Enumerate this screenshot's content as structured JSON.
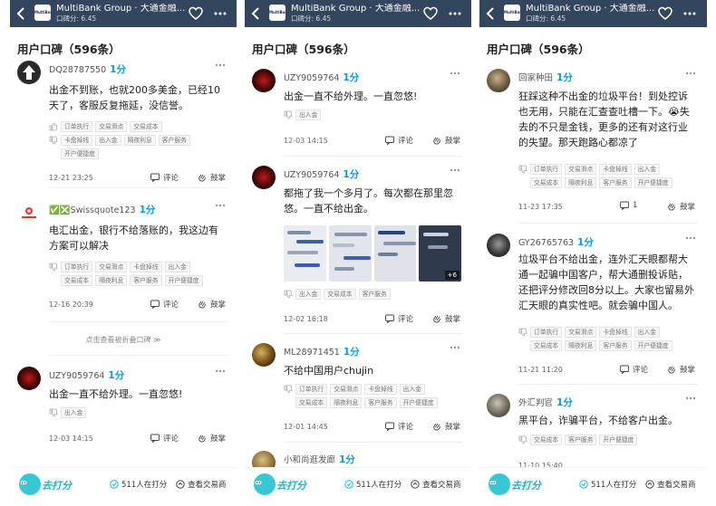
{
  "header": {
    "title": "MultiBank Group · 大通金融...",
    "subtitle": "口碑分: 6.45",
    "logo_text": "MultiBank"
  },
  "section_title": "用户口碑（596条）",
  "actions": {
    "comment": "评论",
    "like": "鼓掌"
  },
  "fold_text": "点击查看被折叠口碑",
  "bottom_bar": {
    "logo_text": "去打分",
    "rating_count": "511人在打分",
    "view": "查看交易商"
  },
  "panels": [
    {
      "reviews": [
        {
          "user": "DQ28787550",
          "score": "1分",
          "text": "出金不到账，也就200多美金，已经10天了，客服反复拖延，没信誉。",
          "tags1": [
            "订单执行",
            "交易滑点",
            "交易成本"
          ],
          "tags2": [
            "卡盘掉线",
            "出入金",
            "隔夜利息",
            "客户服务"
          ],
          "tags3": [
            "开户便捷度"
          ],
          "date": "12-21 23:25"
        },
        {
          "user": "✅❎Swissquote123",
          "score": "1分",
          "avatar_text": "Swissquote",
          "text": "电汇出金，银行不给落账的，我这边有方案可以解决",
          "tags1": [
            "订单执行",
            "交易滑点",
            "卡盘掉线",
            "出入金"
          ],
          "tags2": [
            "交易成本",
            "隔夜利息",
            "客户服务",
            "开户便捷度"
          ],
          "date": "12-16 20:39"
        },
        {
          "user": "UZY9059764",
          "score": "1分",
          "text": "出金一直不给外理。一直忽悠!",
          "tags1": [
            "出入金"
          ],
          "date": "12-03 14:15"
        }
      ]
    },
    {
      "reviews": [
        {
          "user": "UZY9059764",
          "score": "1分",
          "text": "出金一直不给外理。一直忽悠!",
          "tags1": [
            "出入金"
          ],
          "date": "12-03 14:15"
        },
        {
          "user": "UZY9059764",
          "score": "1分",
          "text": "都拖了我一个多月了。每次都在那里忽悠。一直不给出金。",
          "photo_more": "+6",
          "tags1": [
            "出入金",
            "交易成本",
            "客户服务"
          ],
          "date": "12-02 16:18"
        },
        {
          "user": "ML28971451",
          "score": "1分",
          "text": "不给中国用户chujin",
          "tags1": [
            "订单执行",
            "交易滑点",
            "卡盘掉线",
            "出入金"
          ],
          "tags2": [
            "交易成本",
            "隔夜利息",
            "客户服务",
            "开户便捷度"
          ],
          "date": "12-01 14:45"
        },
        {
          "user": "小和尚逛发廊",
          "score": "1分"
        }
      ]
    },
    {
      "reviews": [
        {
          "user": "回家种田",
          "score": "1分",
          "text": "狂踩这种不出金的垃圾平台！到处控诉也无用，只能在汇查查吐槽一下。😭失去的不只是金钱，更多的还有对这行业的失望。那天跑路心都凉了",
          "tags1": [
            "订单执行",
            "交易滑点",
            "卡盘掉线",
            "出入金"
          ],
          "tags2": [
            "交易成本",
            "隔夜利息",
            "客户服务",
            "开户便捷度"
          ],
          "date": "11-23 17:35",
          "comment_count": "1"
        },
        {
          "user": "GY26765763",
          "score": "1分",
          "text": "垃圾平台不给出金，连外汇天眼都帮大通一起骗中国客户，帮大通删投诉贴，还把评分修改回8分以上。大家也留易外汇天眼的真实性吧。就会骗中国人。",
          "tags1": [
            "订单执行",
            "交易滑点",
            "卡盘掉线",
            "出入金"
          ],
          "tags2": [
            "交易成本",
            "隔夜利息",
            "客户服务",
            "开户便捷度"
          ],
          "date": "11-21 11:20"
        },
        {
          "user": "外汇判官",
          "score": "1分",
          "text": "黑平台，诈骗平台，不给客户出金。",
          "tags1": [
            "交易成本",
            "客户服务",
            "开户便捷度"
          ],
          "date": "11-10 15:40"
        }
      ]
    }
  ]
}
